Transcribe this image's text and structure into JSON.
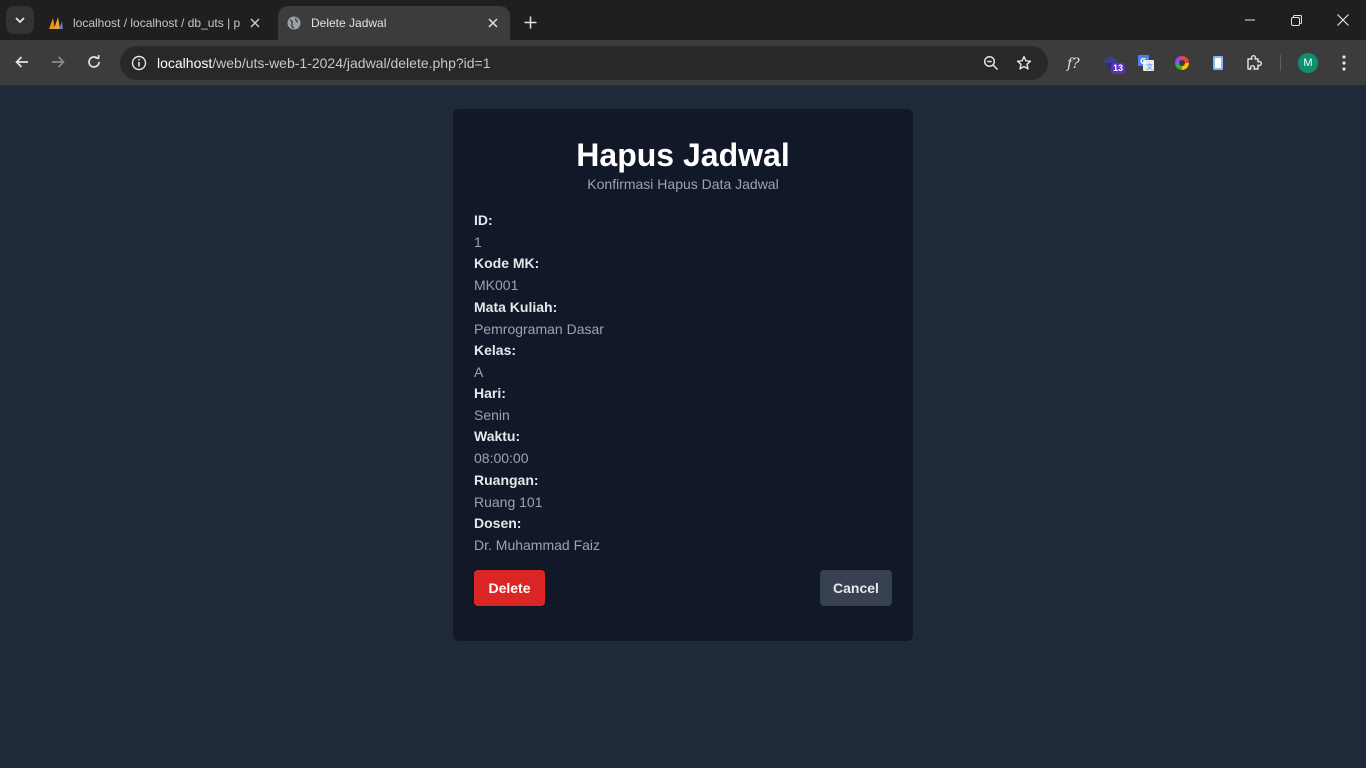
{
  "browser": {
    "tabs": [
      {
        "title": "localhost / localhost / db_uts | p",
        "active": false
      },
      {
        "title": "Delete Jadwal",
        "active": true
      }
    ],
    "url_host": "localhost",
    "url_path": "/web/uts-web-1-2024/jadwal/delete.php?id=1",
    "extension_badge": "13",
    "profile_initial": "M",
    "icons": [
      "chevron-down-icon",
      "phpmyadmin-icon",
      "globe-icon",
      "close-icon",
      "plus-icon",
      "minimize-icon",
      "restore-icon",
      "back-icon",
      "forward-icon",
      "reload-icon",
      "info-icon",
      "zoom-icon",
      "star-icon",
      "function-extension-icon",
      "shield-extension-icon",
      "translate-extension-icon",
      "color-extension-icon",
      "document-extension-icon",
      "puzzle-icon",
      "menu-dots-icon"
    ]
  },
  "page": {
    "title": "Hapus Jadwal",
    "subtitle": "Konfirmasi Hapus Data Jadwal",
    "fields": [
      {
        "label": "ID:",
        "value": "1"
      },
      {
        "label": "Kode MK:",
        "value": "MK001"
      },
      {
        "label": "Mata Kuliah:",
        "value": "Pemrograman Dasar"
      },
      {
        "label": "Kelas:",
        "value": "A"
      },
      {
        "label": "Hari:",
        "value": "Senin"
      },
      {
        "label": "Waktu:",
        "value": "08:00:00"
      },
      {
        "label": "Ruangan:",
        "value": "Ruang 101"
      },
      {
        "label": "Dosen:",
        "value": "Dr. Muhammad Faiz"
      }
    ],
    "delete_label": "Delete",
    "cancel_label": "Cancel",
    "colors": {
      "background": "#1f2937",
      "card": "#111827",
      "delete_button": "#dc2626",
      "cancel_button": "#374151"
    }
  }
}
